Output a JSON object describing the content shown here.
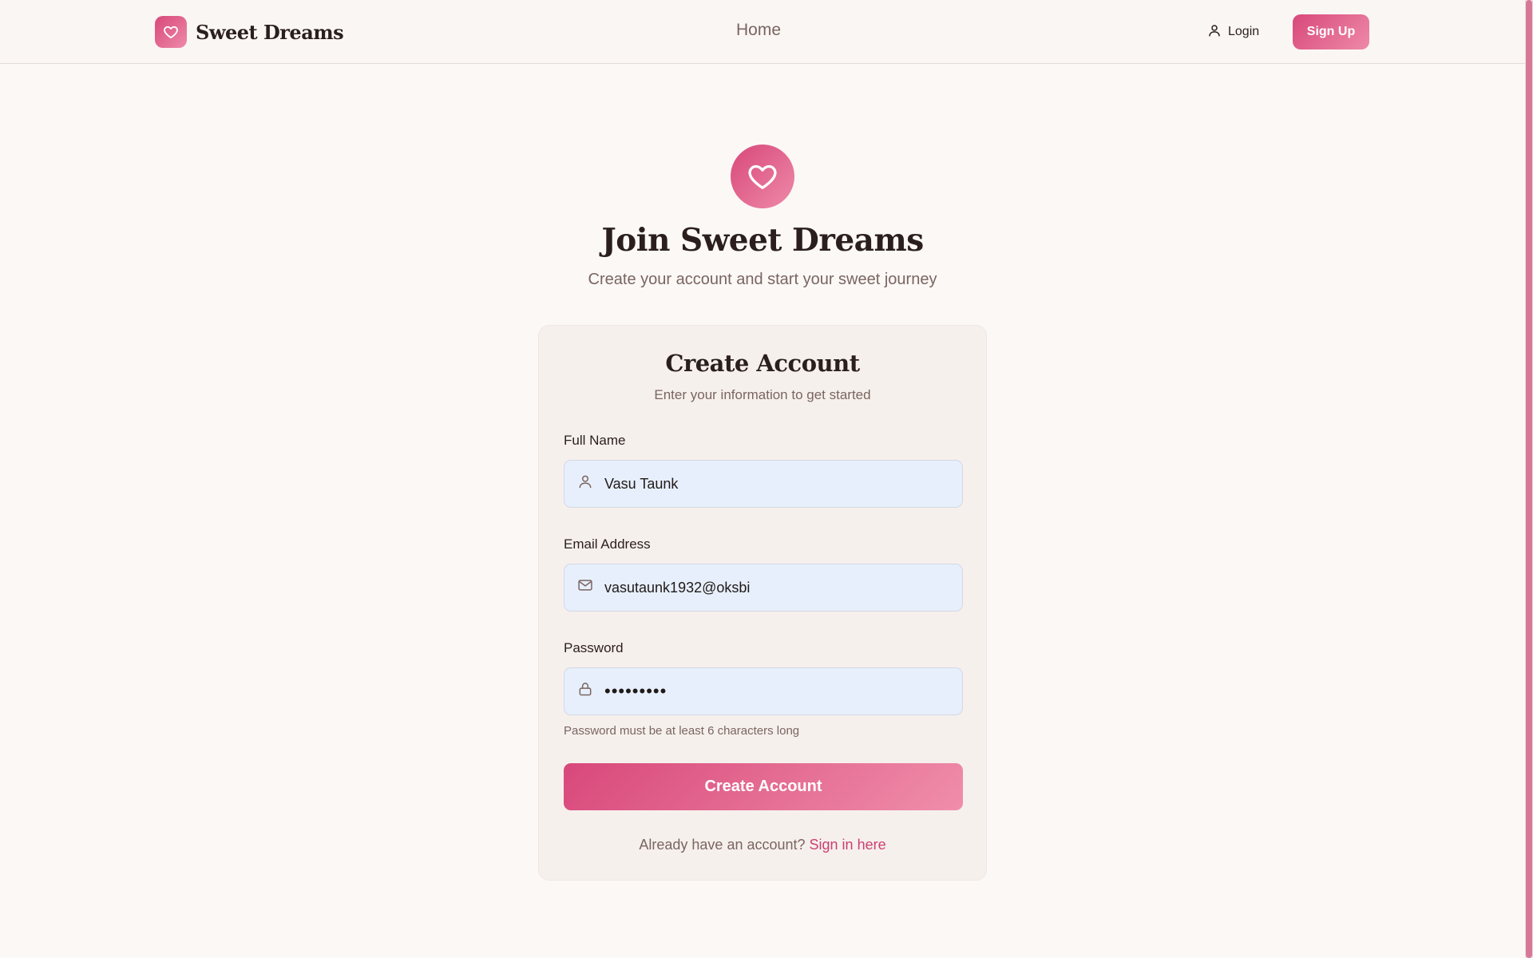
{
  "header": {
    "brand": "Sweet Dreams",
    "nav_home": "Home",
    "login_label": "Login",
    "signup_label": "Sign Up"
  },
  "hero": {
    "icon": "heart-icon",
    "title": "Join Sweet Dreams",
    "subtitle": "Create your account and start your sweet journey"
  },
  "form": {
    "title": "Create Account",
    "subtitle": "Enter your information to get started",
    "full_name": {
      "label": "Full Name",
      "value": "Vasu Taunk",
      "icon": "user-icon"
    },
    "email": {
      "label": "Email Address",
      "value": "vasutaunk1932@oksbi",
      "icon": "mail-icon"
    },
    "password": {
      "label": "Password",
      "value": "•••••••••",
      "icon": "lock-icon"
    },
    "password_hint": "Password must be at least 6 characters long",
    "submit_label": "Create Account",
    "signin_prompt": "Already have an account?",
    "signin_link": "Sign in here"
  },
  "colors": {
    "accent": "#d8487a",
    "accent_light": "#ee8aa9",
    "background": "#fbf8f6",
    "input_bg": "#e7effc"
  }
}
